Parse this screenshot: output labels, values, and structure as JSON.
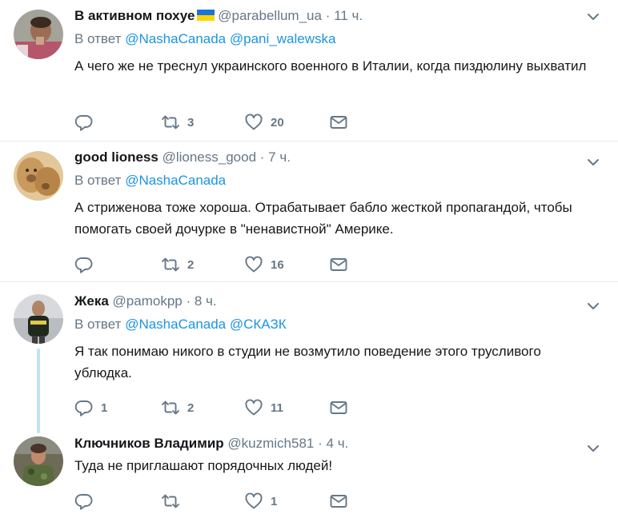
{
  "reply_prefix": "В ответ",
  "tweets": [
    {
      "fullname": "В активном похуе",
      "handle": "@parabellum_ua",
      "separator": "·",
      "time": "11 ч.",
      "reply_to": [
        "@NashaCanada",
        "@pani_walewska"
      ],
      "text": "А чего же не треснул украинского военного в Италии, когда пиздюлину выхватил",
      "retweets": "3",
      "likes": "20",
      "replies": ""
    },
    {
      "fullname": "good lioness",
      "handle": "@lioness_good",
      "separator": "·",
      "time": "7 ч.",
      "reply_to": [
        "@NashaCanada"
      ],
      "text": "А стриженова тоже хороша. Отрабатывает бабло жесткой пропагандой, чтобы помогать своей дочурке в \"ненавистной\" Америке.",
      "retweets": "2",
      "likes": "16",
      "replies": ""
    },
    {
      "fullname": "Жека",
      "handle": "@pamokpp",
      "separator": "·",
      "time": "8 ч.",
      "reply_to": [
        "@NashaCanada",
        "@СКАЗК"
      ],
      "text": "Я так понимаю никого в студии не возмутило поведение этого трусливого ублюдка.",
      "retweets": "2",
      "likes": "11",
      "replies": "1"
    },
    {
      "fullname": "Ключников Владимир",
      "handle": "@kuzmich581",
      "separator": "·",
      "time": "4 ч.",
      "text": "Туда не приглашают порядочных людей!",
      "retweets": "",
      "likes": "1",
      "replies": ""
    }
  ],
  "icons": {
    "reply": "reply-icon",
    "retweet": "retweet-icon",
    "like": "heart-icon",
    "dm": "envelope-icon",
    "caret": "chevron-down-icon"
  },
  "colors": {
    "name": "#14171a",
    "secondary": "#657786",
    "link": "#1b95e0",
    "separator": "#e6ecf0",
    "thread_line": "#bfe3f8",
    "flag_blue": "#1a73d9",
    "flag_yellow": "#ffd500"
  }
}
